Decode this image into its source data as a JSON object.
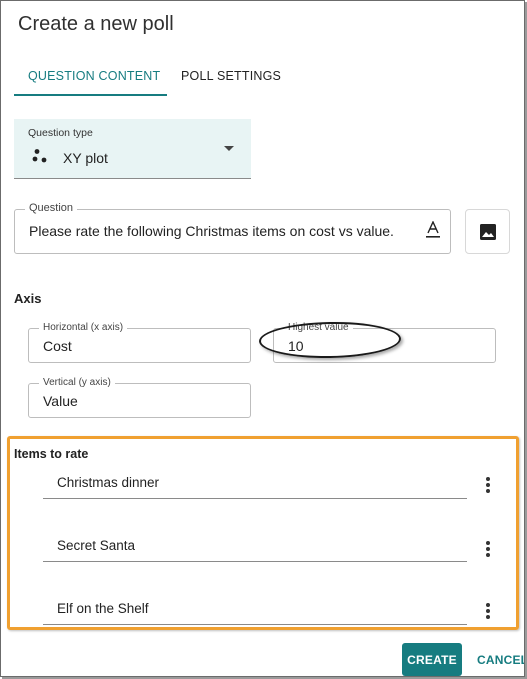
{
  "dialog": {
    "title": "Create a new poll"
  },
  "tabs": [
    {
      "label": "QUESTION CONTENT",
      "active": true
    },
    {
      "label": "POLL SETTINGS",
      "active": false
    }
  ],
  "question_type": {
    "label": "Question type",
    "value": "XY plot",
    "icon": "xy-plot-icon"
  },
  "question": {
    "label": "Question",
    "value": "Please rate the following Christmas items on cost vs value."
  },
  "axis": {
    "heading": "Axis",
    "horizontal": {
      "label": "Horizontal (x axis)",
      "value": "Cost"
    },
    "highest": {
      "label": "Highest value",
      "value": "10"
    },
    "vertical": {
      "label": "Vertical (y axis)",
      "value": "Value"
    }
  },
  "items": {
    "heading": "Items to rate",
    "list": [
      {
        "label": "Christmas dinner"
      },
      {
        "label": "Secret Santa"
      },
      {
        "label": "Elf on the Shelf"
      }
    ]
  },
  "actions": {
    "create_label": "CREATE",
    "cancel_label": "CANCEL"
  },
  "colors": {
    "accent": "#167c80",
    "highlight_box": "#f0a030",
    "qtype_bg": "#e8f4f4"
  }
}
